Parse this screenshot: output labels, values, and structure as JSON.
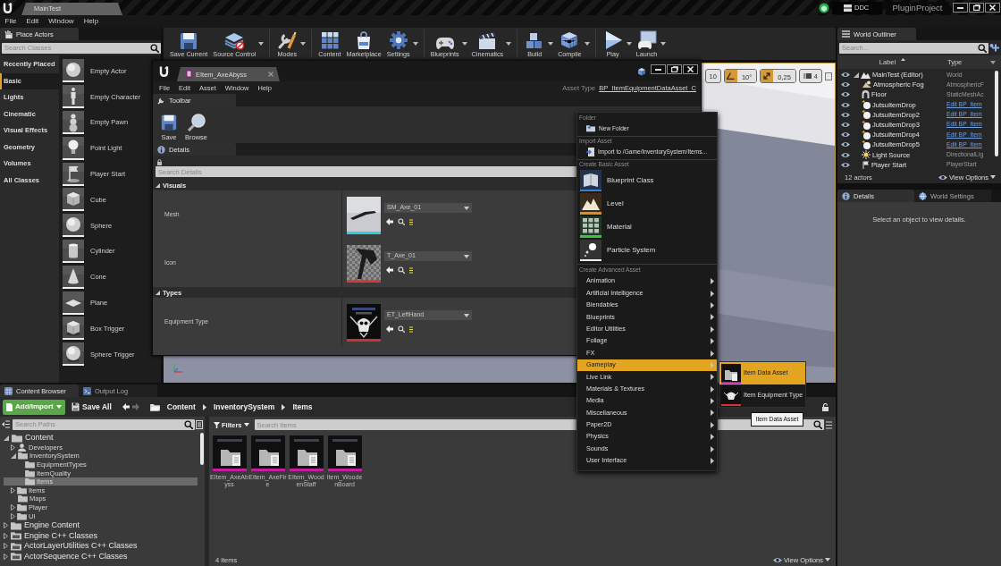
{
  "title_bar": {
    "tab": "MainTest",
    "ddc_button": "DDC",
    "project": "PluginProject"
  },
  "menu_bar": [
    "File",
    "Edit",
    "Window",
    "Help"
  ],
  "place_actors": {
    "tab": "Place Actors",
    "search": {
      "placeholder": "Search Classes"
    },
    "categories": [
      {
        "label": "Recently Placed",
        "selected": false
      },
      {
        "label": "Basic",
        "selected": true
      },
      {
        "label": "Lights",
        "selected": false
      },
      {
        "label": "Cinematic",
        "selected": false
      },
      {
        "label": "Visual Effects",
        "selected": false
      },
      {
        "label": "Geometry",
        "selected": false
      },
      {
        "label": "Volumes",
        "selected": false
      },
      {
        "label": "All Classes",
        "selected": false
      }
    ],
    "items": [
      "Empty Actor",
      "Empty Character",
      "Empty Pawn",
      "Point Light",
      "Player Start",
      "Cube",
      "Sphere",
      "Cylinder",
      "Cone",
      "Plane",
      "Box Trigger",
      "Sphere Trigger"
    ]
  },
  "toolbar": [
    {
      "label": "Save Current",
      "dropdown": false
    },
    {
      "label": "Source Control",
      "dropdown": true
    },
    {
      "label": "Modes",
      "dropdown": true
    },
    {
      "label": "Content",
      "dropdown": false
    },
    {
      "label": "Marketplace",
      "dropdown": false
    },
    {
      "label": "Settings",
      "dropdown": true
    },
    {
      "label": "Blueprints",
      "dropdown": true
    },
    {
      "label": "Cinematics",
      "dropdown": true
    },
    {
      "label": "Build",
      "dropdown": true
    },
    {
      "label": "Compile",
      "dropdown": true
    },
    {
      "label": "Play",
      "dropdown": true
    },
    {
      "label": "Launch",
      "dropdown": true
    }
  ],
  "viewport": {
    "grid_snap": {
      "value": "10"
    },
    "rotation_snap": {
      "value": "10°",
      "on": true
    },
    "scale_snap": {
      "value": "0,25",
      "on": true
    },
    "camera_speed": {
      "value": "4"
    }
  },
  "world_outliner": {
    "tab": "World Outliner",
    "search": {
      "placeholder": "Search..."
    },
    "columns": [
      "Label",
      "Type"
    ],
    "rows": [
      {
        "label": "MainTest (Editor)",
        "type": "World",
        "link": false,
        "expanded": true,
        "children": [
          {
            "label": "Atmospheric Fog",
            "type": "AtmosphericF",
            "link": false
          },
          {
            "label": "Floor",
            "type": "StaticMeshAc",
            "link": false
          },
          {
            "label": "JutsuItemDrop",
            "type": "Edit BP_Item",
            "link": true
          },
          {
            "label": "JutsuItemDrop2",
            "type": "Edit BP_Item",
            "link": true
          },
          {
            "label": "JutsuItemDrop3",
            "type": "Edit BP_Item",
            "link": true
          },
          {
            "label": "JutsuItemDrop4",
            "type": "Edit BP_Item",
            "link": true
          },
          {
            "label": "JutsuItemDrop5",
            "type": "Edit BP_Item",
            "link": true
          },
          {
            "label": "Light Source",
            "type": "DirectionalLig",
            "link": false
          },
          {
            "label": "Player Start",
            "type": "PlayerStart",
            "link": false
          }
        ]
      }
    ],
    "actor_count": "12 actors",
    "view_options": "View Options"
  },
  "details_panel": {
    "tabs": [
      {
        "label": "Details",
        "selected": true
      },
      {
        "label": "World Settings",
        "selected": false
      }
    ],
    "message": "Select an object to view details."
  },
  "content_browser": {
    "tabs": [
      {
        "label": "Content Browser",
        "selected": true
      },
      {
        "label": "Output Log",
        "selected": false
      }
    ],
    "add_button": "Add/Import",
    "save_all": "Save All",
    "back_enabled": true,
    "forward_enabled": false,
    "breadcrumbs": [
      "Content",
      "InventorySystem",
      "Items"
    ],
    "path_search": {
      "placeholder": "Search Paths"
    },
    "tree": [
      {
        "label": "Content",
        "kind": "folder",
        "expanded": true,
        "selected": false,
        "children": [
          {
            "label": "Developers",
            "kind": "user",
            "expanded": false,
            "selected": false
          },
          {
            "label": "InventorySystem",
            "kind": "folder",
            "expanded": true,
            "selected": false,
            "children": [
              {
                "label": "EquipmentTypes",
                "kind": "folder",
                "selected": false
              },
              {
                "label": "ItemQuality",
                "kind": "folder",
                "selected": false
              },
              {
                "label": "Items",
                "kind": "folder",
                "selected": true
              }
            ]
          },
          {
            "label": "Items",
            "kind": "folder",
            "expanded": false,
            "selected": false
          },
          {
            "label": "Maps",
            "kind": "folder",
            "selected": false
          },
          {
            "label": "Player",
            "kind": "folder",
            "expanded": false,
            "selected": false
          },
          {
            "label": "UI",
            "kind": "folder",
            "expanded": false,
            "selected": false
          }
        ]
      },
      {
        "label": "Engine Content",
        "kind": "folder",
        "expanded": false,
        "selected": false
      },
      {
        "label": "Engine C++ Classes",
        "kind": "classes",
        "expanded": false,
        "selected": false
      },
      {
        "label": "ActorLayerUtilities C++ Classes",
        "kind": "classes",
        "expanded": false,
        "selected": false
      },
      {
        "label": "ActorSequence C++ Classes",
        "kind": "classes",
        "expanded": false,
        "selected": false
      }
    ],
    "filters": "Filters",
    "asset_search": {
      "placeholder": "Search Items"
    },
    "assets": [
      {
        "name": "EItem_AxeAbyss"
      },
      {
        "name": "EItem_AxeFire"
      },
      {
        "name": "EItem_WoodenStaff"
      },
      {
        "name": "Item_WoodenBoard"
      }
    ],
    "item_count": "4 items",
    "view_options": "View Options"
  },
  "asset_editor": {
    "tab": "EItem_AxeAbyss",
    "menu": [
      "File",
      "Edit",
      "Asset",
      "Window",
      "Help"
    ],
    "asset_type_label": "Asset Type",
    "asset_type": "BP_ItemEquipmentDataAsset_C",
    "toolbar_tab": "Toolbar",
    "toolbar": [
      "Save",
      "Browse"
    ],
    "details_tab": "Details",
    "search": {
      "placeholder": "Search Details"
    },
    "sections": [
      {
        "title": "Visuals",
        "expanded": true,
        "properties": [
          {
            "name": "Mesh",
            "value": "SM_Axe_01"
          },
          {
            "name": "Icon",
            "value": "T_Axe_01"
          }
        ]
      },
      {
        "title": "Types",
        "expanded": true,
        "properties": [
          {
            "name": "Equipment Type",
            "value": "ET_LeftHand"
          }
        ]
      }
    ]
  },
  "context_menu": {
    "sections": [
      {
        "title": "Folder",
        "kind": "small",
        "items": [
          {
            "label": "New Folder",
            "selected": false
          }
        ]
      },
      {
        "title": "Import Asset",
        "kind": "small",
        "items": [
          {
            "label": "Import to /Game/InventorySystem/Items...",
            "selected": false
          }
        ]
      },
      {
        "title": "Create Basic Asset",
        "kind": "large",
        "items": [
          {
            "label": "Blueprint Class",
            "selected": false
          },
          {
            "label": "Level",
            "selected": false
          },
          {
            "label": "Material",
            "selected": false
          },
          {
            "label": "Particle System",
            "selected": false
          }
        ]
      },
      {
        "title": "Create Advanced Asset",
        "kind": "submenu",
        "items": [
          {
            "label": "Animation",
            "selected": false
          },
          {
            "label": "Artificial Intelligence",
            "selected": false
          },
          {
            "label": "Blendables",
            "selected": false
          },
          {
            "label": "Blueprints",
            "selected": false
          },
          {
            "label": "Editor Utilities",
            "selected": false
          },
          {
            "label": "Foliage",
            "selected": false
          },
          {
            "label": "FX",
            "selected": false
          },
          {
            "label": "Gameplay",
            "selected": true
          },
          {
            "label": "Live Link",
            "selected": false
          },
          {
            "label": "Materials & Textures",
            "selected": false
          },
          {
            "label": "Media",
            "selected": false
          },
          {
            "label": "Miscellaneous",
            "selected": false
          },
          {
            "label": "Paper2D",
            "selected": false
          },
          {
            "label": "Physics",
            "selected": false
          },
          {
            "label": "Sounds",
            "selected": false
          },
          {
            "label": "User Interface",
            "selected": false
          }
        ]
      }
    ]
  },
  "submenu": {
    "items": [
      {
        "label": "Item Data Asset",
        "selected": true
      },
      {
        "label": "Item Equipment Type",
        "selected": false
      }
    ]
  },
  "tooltip": "Item Data Asset"
}
